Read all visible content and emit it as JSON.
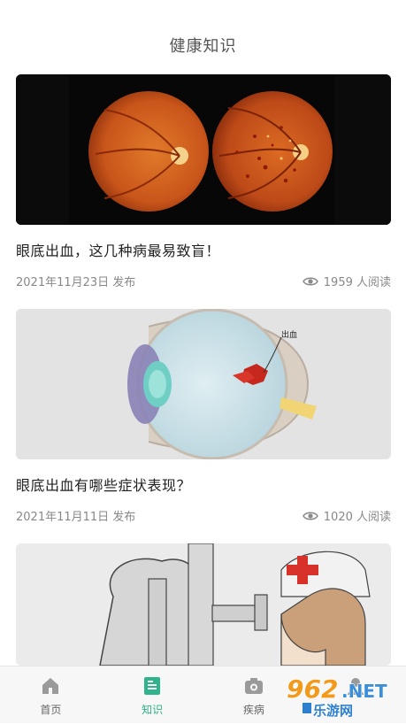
{
  "header": {
    "title": "健康知识"
  },
  "articles": [
    {
      "title": "眼底出血，这几种病最易致盲！",
      "date": "2021年11月23日 发布",
      "views": "1959 人阅读"
    },
    {
      "title": "眼底出血有哪些症状表现？",
      "date": "2021年11月11日 发布",
      "views": "1020 人阅读",
      "image_label": "出血"
    },
    {
      "title": "",
      "date": "",
      "views": ""
    }
  ],
  "tabbar": {
    "items": [
      {
        "label": "首页",
        "icon": "home-icon"
      },
      {
        "label": "知识",
        "icon": "knowledge-icon",
        "active": true
      },
      {
        "label": "疾病",
        "icon": "disease-icon"
      },
      {
        "label": "",
        "icon": "profile-icon"
      }
    ]
  },
  "watermark": {
    "number": "962",
    "suffix": ".NET",
    "site": "乐游网"
  },
  "colors": {
    "accent": "#2fb38a",
    "text": "#222222",
    "muted": "#888888"
  }
}
